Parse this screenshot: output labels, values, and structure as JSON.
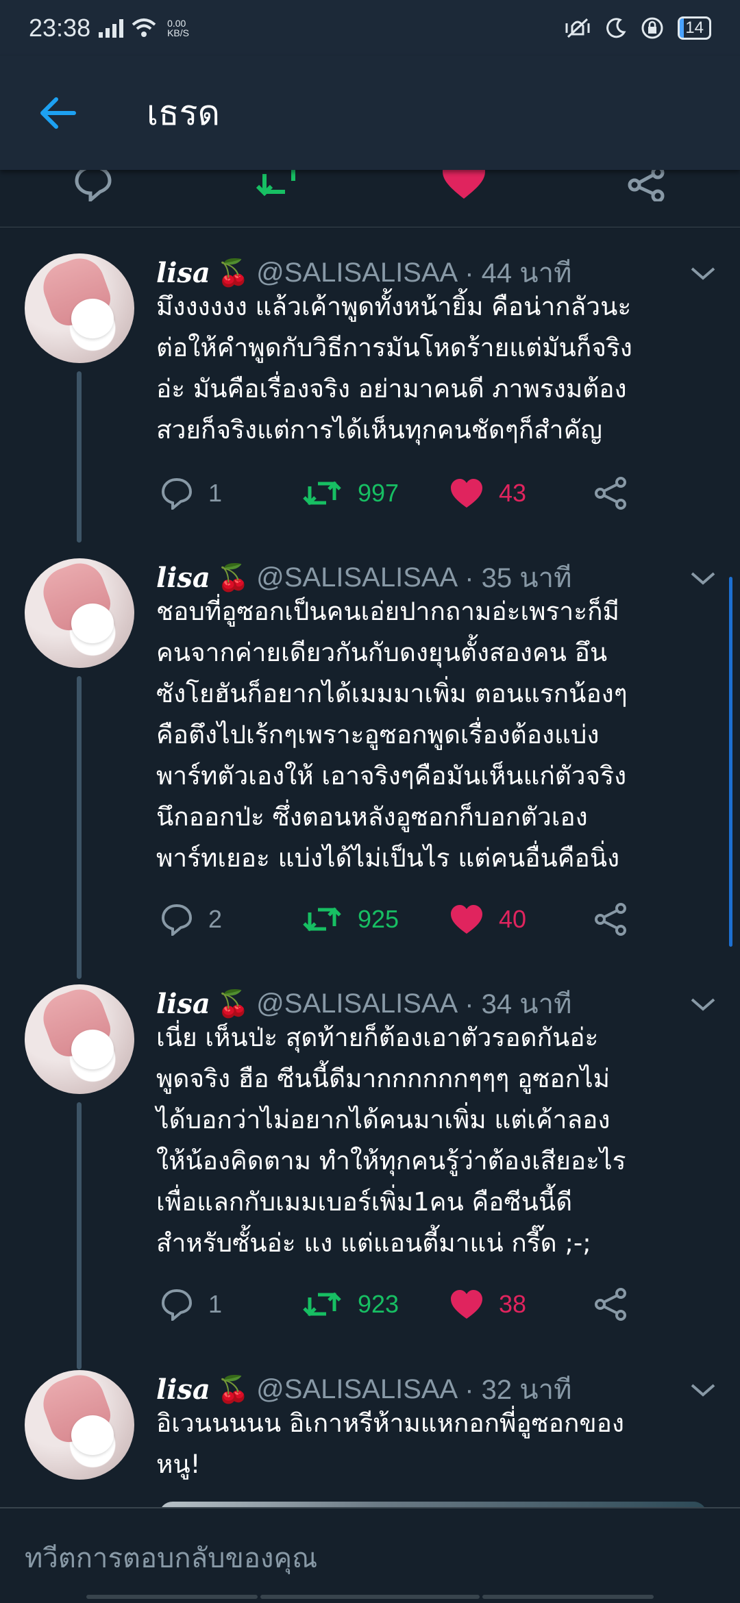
{
  "status_bar": {
    "time": "23:38",
    "net_speed_value": "0.00",
    "net_speed_unit": "KB/S",
    "battery": "14"
  },
  "appbar": {
    "title": "เธรด"
  },
  "compose": {
    "placeholder": "ทวีตการตอบกลับของคุณ"
  },
  "tweets": [
    {
      "name": "lisa",
      "emoji": "🍒",
      "handle": "@SALISALISAA",
      "time": "· 44 นาที",
      "text": "มึงงงงงง แล้วเค้าพูดทั้งหน้ายิ้ม คือน่ากลัวนะ\nต่อให้คำพูดกับวิธีการมันโหดร้ายแต่มันก็จริง\nอ่ะ มันคือเรื่องจริง อย่ามาคนดี ภาพรงมต้อง\nสวยก็จริงแต่การได้เห็นทุกคนชัดๆก็สำคัญ",
      "replies": "1",
      "retweets": "997",
      "likes": "43"
    },
    {
      "name": "lisa",
      "emoji": "🍒",
      "handle": "@SALISALISAA",
      "time": "· 35 นาที",
      "text": "ชอบที่อูซอกเป็นคนเอ่ยปากถามอ่ะเพราะก็มี\nคนจากค่ายเดียวกันกับดงยุนตั้งสองคน อึน\nซังโยฮันก็อยากได้เมมมาเพิ่ม ตอนแรกน้องๆ\nคือตึงไปเร้กๆเพราะอูซอกพูดเรื่องต้องแบ่ง\nพาร์ทตัวเองให้ เอาจริงๆคือมันเห็นแก่ตัวจริง\nนึกออกป่ะ ซึ่งตอนหลังอูซอกก็บอกตัวเอง\nพาร์ทเยอะ แบ่งได้ไม่เป็นไร แต่คนอื่นคือนิ่ง",
      "replies": "2",
      "retweets": "925",
      "likes": "40"
    },
    {
      "name": "lisa",
      "emoji": "🍒",
      "handle": "@SALISALISAA",
      "time": "· 34 นาที",
      "text": "เนี่ย เห็นป่ะ สุดท้ายก็ต้องเอาตัวรอดกันอ่ะ\nพูดจริง ฮือ ซีนนี้ดีมากกกกกกๆๆๆ อูซอกไม่\nได้บอกว่าไม่อยากได้คนมาเพิ่ม แต่เค้าลอง\nให้น้องคิดตาม ทำให้ทุกคนรู้ว่าต้องเสียอะไร\nเพื่อแลกกับเมมเบอร์เพิ่ม1คน คือซีนนี้ดี\nสำหรับซั้นอ่ะ แง แต่แอนตี้มาแน่ กรี๊ด ;-;",
      "replies": "1",
      "retweets": "923",
      "likes": "38"
    },
    {
      "name": "lisa",
      "emoji": "🍒",
      "handle": "@SALISALISAA",
      "time": "· 32 นาที",
      "text": "อิเวนนนนน อิเกาหรีห้ามแหกอกพี่อูซอกของ\nหนู!"
    }
  ],
  "colors": {
    "background": "#15202b",
    "accent": "#1da1f2",
    "retweet": "#17bf63",
    "like": "#e0245e",
    "muted": "#8899a6"
  }
}
